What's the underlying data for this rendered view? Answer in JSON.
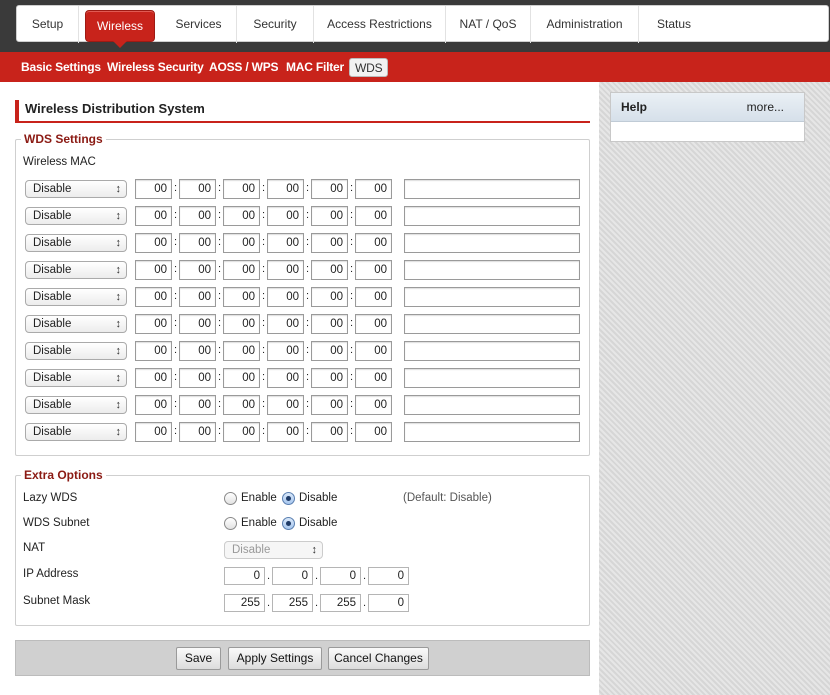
{
  "nav": {
    "tabs": [
      {
        "label": "Setup"
      },
      {
        "label": "Wireless"
      },
      {
        "label": "Services"
      },
      {
        "label": "Security"
      },
      {
        "label": "Access Restrictions"
      },
      {
        "label": "NAT / QoS"
      },
      {
        "label": "Administration"
      },
      {
        "label": "Status"
      }
    ],
    "active_tab": "Wireless"
  },
  "subnav": {
    "items": [
      {
        "label": "Basic Settings"
      },
      {
        "label": "Wireless Security"
      },
      {
        "label": "AOSS / WPS"
      },
      {
        "label": "MAC Filter"
      },
      {
        "label": "WDS"
      }
    ],
    "active": "WDS"
  },
  "page_title": "Wireless Distribution System",
  "wds_settings": {
    "legend": "WDS Settings",
    "mac_label": "Wireless MAC",
    "separator": ":",
    "rows": [
      {
        "mode": "Disable",
        "mac": [
          "00",
          "00",
          "00",
          "00",
          "00",
          "00"
        ],
        "description": ""
      },
      {
        "mode": "Disable",
        "mac": [
          "00",
          "00",
          "00",
          "00",
          "00",
          "00"
        ],
        "description": ""
      },
      {
        "mode": "Disable",
        "mac": [
          "00",
          "00",
          "00",
          "00",
          "00",
          "00"
        ],
        "description": ""
      },
      {
        "mode": "Disable",
        "mac": [
          "00",
          "00",
          "00",
          "00",
          "00",
          "00"
        ],
        "description": ""
      },
      {
        "mode": "Disable",
        "mac": [
          "00",
          "00",
          "00",
          "00",
          "00",
          "00"
        ],
        "description": ""
      },
      {
        "mode": "Disable",
        "mac": [
          "00",
          "00",
          "00",
          "00",
          "00",
          "00"
        ],
        "description": ""
      },
      {
        "mode": "Disable",
        "mac": [
          "00",
          "00",
          "00",
          "00",
          "00",
          "00"
        ],
        "description": ""
      },
      {
        "mode": "Disable",
        "mac": [
          "00",
          "00",
          "00",
          "00",
          "00",
          "00"
        ],
        "description": ""
      },
      {
        "mode": "Disable",
        "mac": [
          "00",
          "00",
          "00",
          "00",
          "00",
          "00"
        ],
        "description": ""
      },
      {
        "mode": "Disable",
        "mac": [
          "00",
          "00",
          "00",
          "00",
          "00",
          "00"
        ],
        "description": ""
      }
    ]
  },
  "extra_options": {
    "legend": "Extra Options",
    "lazy_wds": {
      "label": "Lazy WDS",
      "enable": "Enable",
      "disable": "Disable",
      "selected": "Disable",
      "default_note": "(Default: Disable)"
    },
    "wds_subnet": {
      "label": "WDS Subnet",
      "enable": "Enable",
      "disable": "Disable",
      "selected": "Disable"
    },
    "nat": {
      "label": "NAT",
      "value": "Disable"
    },
    "ip_address": {
      "label": "IP Address",
      "octets": [
        "0",
        "0",
        "0",
        "0"
      ]
    },
    "subnet_mask": {
      "label": "Subnet Mask",
      "octets": [
        "255",
        "255",
        "255",
        "0"
      ]
    },
    "ip_separator": "."
  },
  "buttons": {
    "save": "Save",
    "apply": "Apply Settings",
    "cancel": "Cancel Changes"
  },
  "help": {
    "title": "Help",
    "more": "more..."
  },
  "colors": {
    "accent": "#c8231b",
    "legend": "#8b1a13"
  }
}
